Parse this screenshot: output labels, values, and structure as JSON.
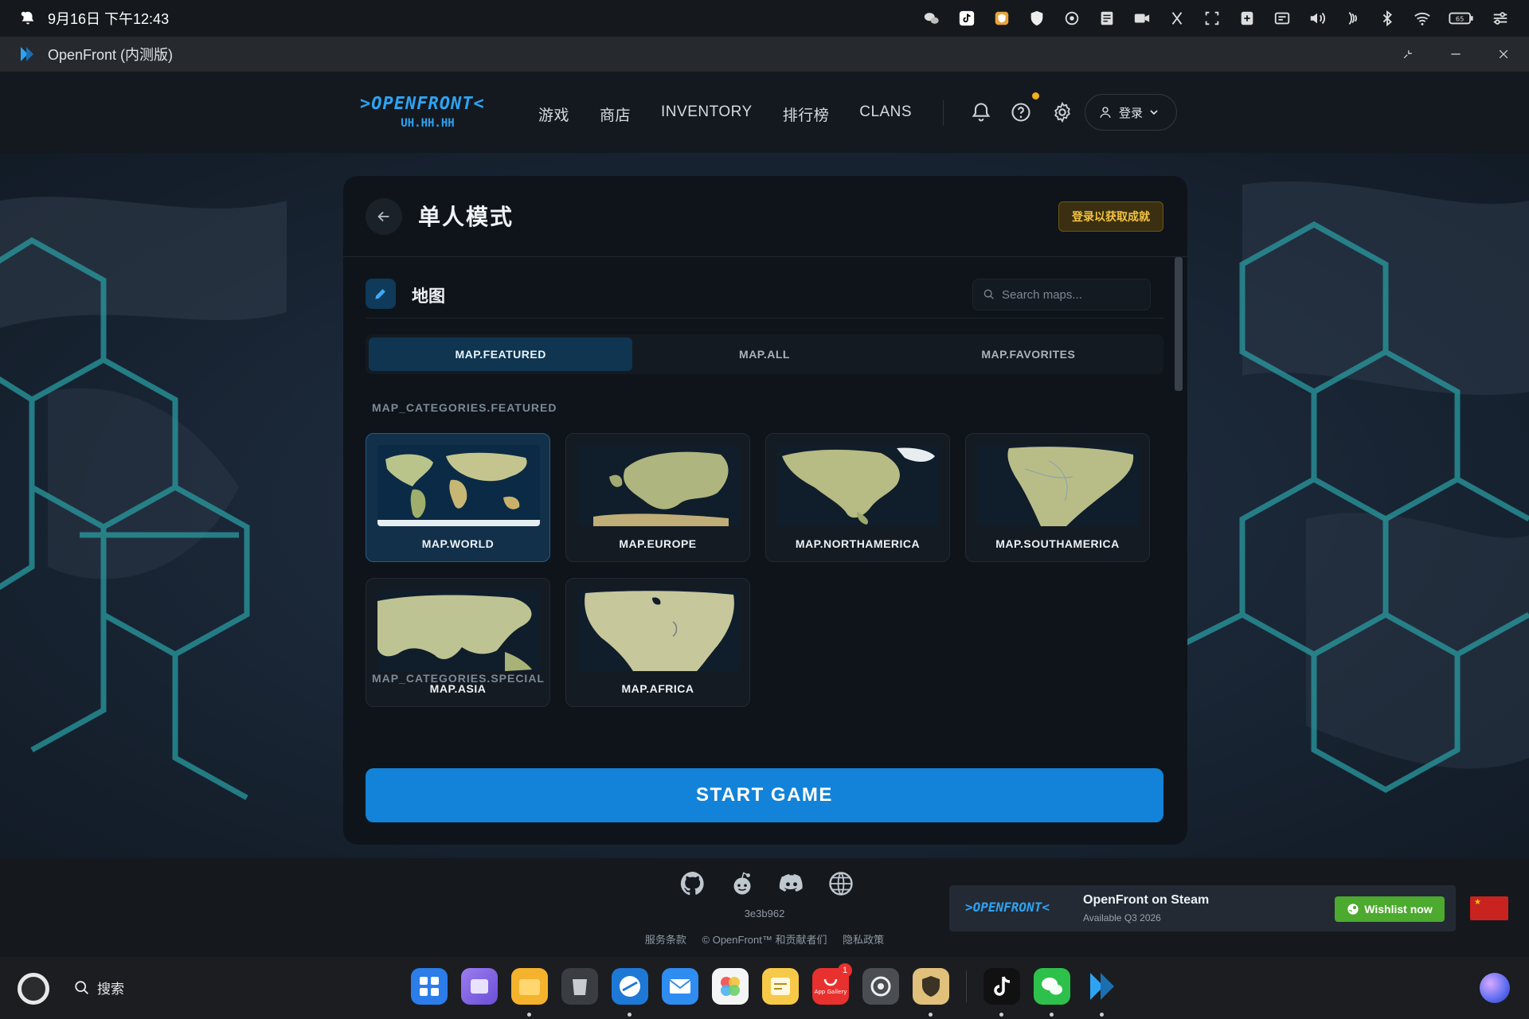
{
  "os": {
    "clock": "9月16日 下午12:43",
    "tray_icons": [
      "wechat-icon",
      "tiktok-icon",
      "shield-app-icon",
      "security-icon",
      "ai-icon",
      "notes-icon",
      "camera-icon",
      "screenshot-icon",
      "crop-icon",
      "calculator-icon",
      "keyboard-icon",
      "volume-icon",
      "nfc-icon",
      "bluetooth-icon",
      "wifi-icon",
      "battery-icon",
      "settings-sliders-icon"
    ],
    "battery": "65"
  },
  "window": {
    "title": "OpenFront (内测版)"
  },
  "header": {
    "brand_line1": ">OPENFRONT<",
    "brand_line2": "UH.HH.HH",
    "nav": [
      "游戏",
      "商店",
      "INVENTORY",
      "排行榜",
      "CLANS"
    ],
    "login_label": "登录"
  },
  "panel": {
    "title": "单人模式",
    "achievements_label": "登录以获取成就",
    "section_title": "地图",
    "search_placeholder": "Search maps...",
    "tabs": [
      "MAP.FEATURED",
      "MAP.ALL",
      "MAP.FAVORITES"
    ],
    "active_tab": 0,
    "category_featured": "MAP_CATEGORIES.FEATURED",
    "category_special": "MAP_CATEGORIES.SPECIAL",
    "maps": [
      {
        "name": "MAP.WORLD",
        "selected": true
      },
      {
        "name": "MAP.EUROPE",
        "selected": false
      },
      {
        "name": "MAP.NORTHAMERICA",
        "selected": false
      },
      {
        "name": "MAP.SOUTHAMERICA",
        "selected": false
      },
      {
        "name": "MAP.ASIA",
        "selected": false
      },
      {
        "name": "MAP.AFRICA",
        "selected": false
      }
    ],
    "start_label": "START GAME"
  },
  "footer": {
    "version": "3e3b962",
    "links": [
      "服务条款",
      "© OpenFront™ 和贡献者们",
      "隐私政策"
    ],
    "steam_logo": ">OPENFRONT<",
    "steam_title": "OpenFront on Steam",
    "steam_sub": "Available Q3 2026",
    "wishlist_label": "Wishlist now"
  },
  "taskbar": {
    "search_label": "搜索",
    "app_gallery_badge": "1",
    "app_gallery_label": "App Gallery"
  },
  "colors": {
    "accent": "#1283d8",
    "gold": "#f2c443",
    "steam_green": "#4caa2e"
  }
}
